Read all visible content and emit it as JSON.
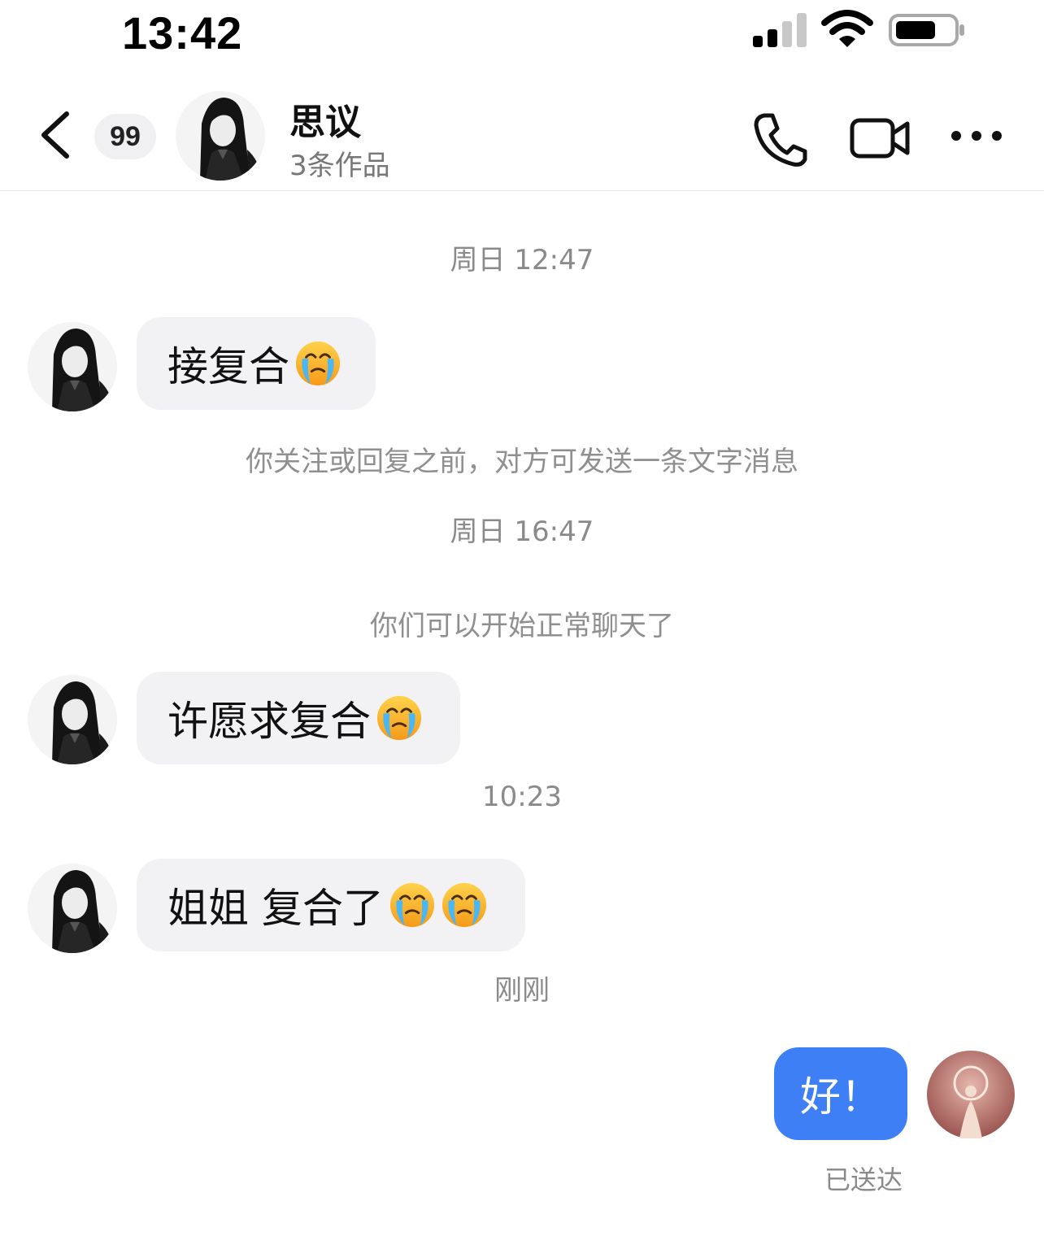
{
  "status_bar": {
    "time": "13:42",
    "icons": [
      "cellular-signal-icon",
      "wifi-icon",
      "battery-icon"
    ]
  },
  "header": {
    "unread_count": "99",
    "contact_name": "思议",
    "contact_subtitle": "3条作品",
    "icons": [
      "back-arrow-icon",
      "phone-icon",
      "video-camera-icon",
      "more-dots-icon"
    ]
  },
  "messages": {
    "ts1": "周日 12:47",
    "msg1": "接复合",
    "sys1": "你关注或回复之前，对方可发送一条文字消息",
    "ts2": "周日 16:47",
    "sys2": "你们可以开始正常聊天了",
    "msg2": "许愿求复合",
    "ts3": "10:23",
    "msg3": "姐姐 复合了",
    "ts4": "刚刚",
    "my_msg": "好！",
    "delivered": "已送达"
  },
  "colors": {
    "outgoing_bubble": "#3f7ff5",
    "incoming_bubble": "#f2f2f4",
    "muted_text": "#8a8a8a"
  }
}
